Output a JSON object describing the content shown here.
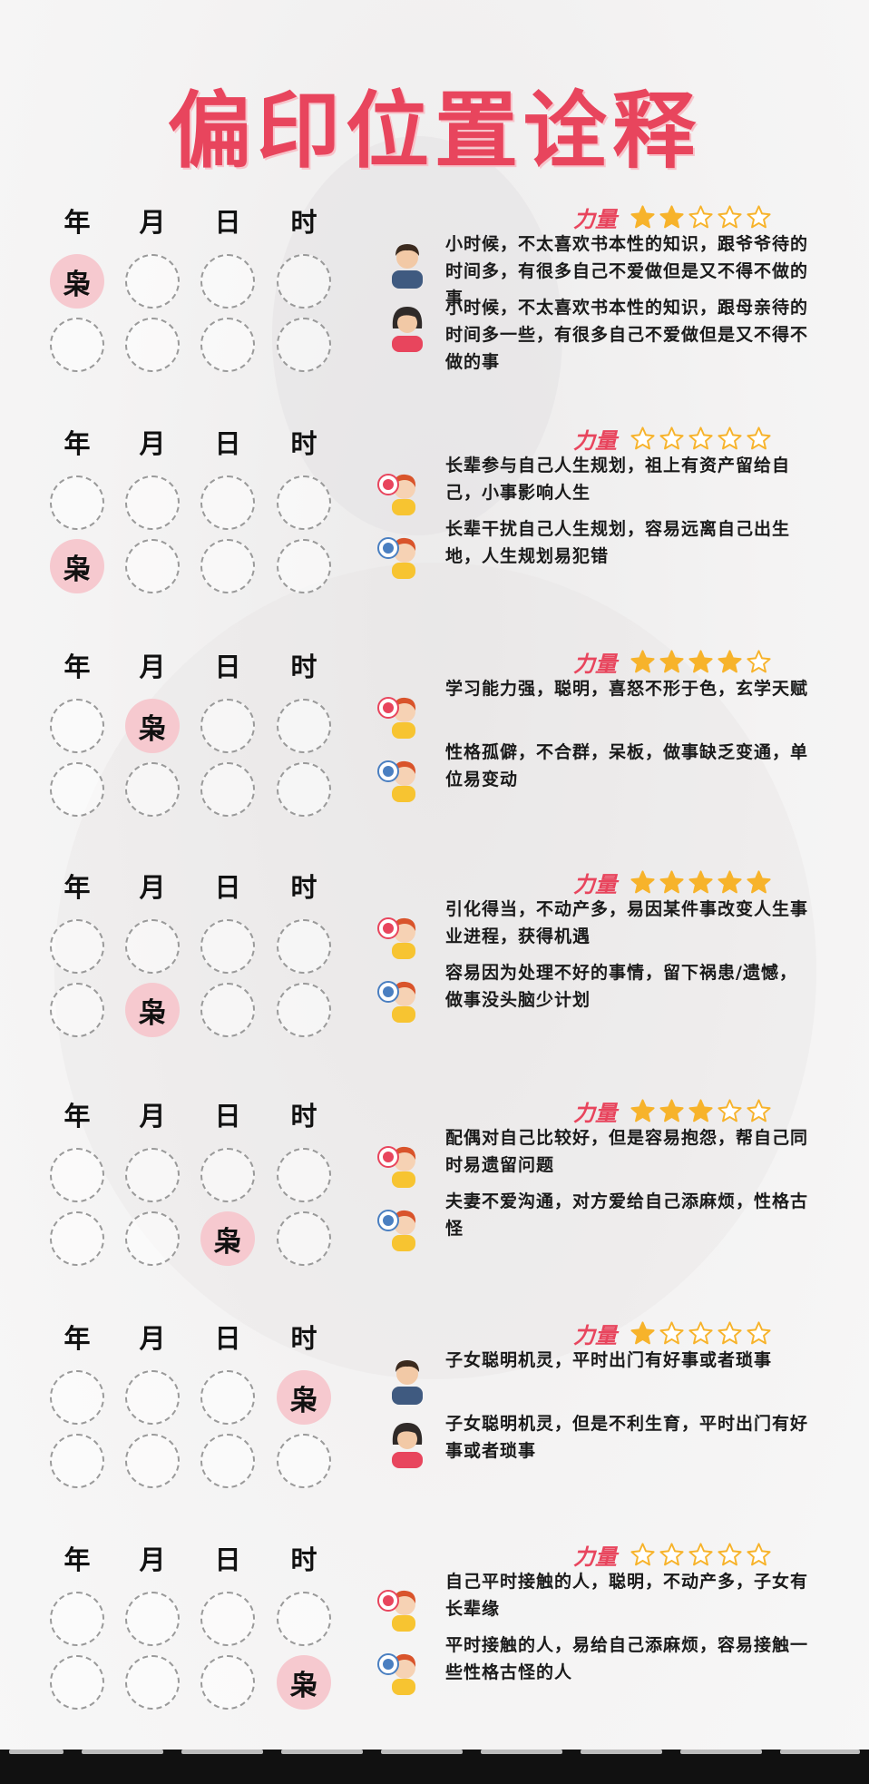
{
  "title": "偏印位置诠释",
  "columns": [
    "年",
    "月",
    "日",
    "时"
  ],
  "active_char": "枭",
  "power_label": "力量",
  "colors": {
    "accent": "#e8455d",
    "star": "#f7b32b",
    "active_circle": "#f6c9cf"
  },
  "sections": [
    {
      "active": {
        "row": 0,
        "col": 0
      },
      "stars": 2,
      "avatar_type": "person",
      "entries": [
        {
          "icon": "male-avatar-icon",
          "text": "小时候，不太喜欢书本性的知识，跟爷爷待的时间多，有很多自己不爱做但是又不得不做的事"
        },
        {
          "icon": "female-avatar-icon",
          "text": "小时候，不太喜欢书本性的知识，跟母亲待的时间多一些，有很多自己不爱做但是又不得不做的事"
        }
      ]
    },
    {
      "active": {
        "row": 1,
        "col": 0
      },
      "stars": 0,
      "avatar_type": "face",
      "entries": [
        {
          "icon": "happy-face-icon",
          "text": "长辈参与自己人生规划，祖上有资产留给自己，小事影响人生"
        },
        {
          "icon": "worried-face-icon",
          "text": "长辈干扰自己人生规划，容易远离自己出生地，人生规划易犯错"
        }
      ]
    },
    {
      "active": {
        "row": 0,
        "col": 1
      },
      "stars": 4,
      "avatar_type": "face",
      "entries": [
        {
          "icon": "happy-face-icon",
          "text": "学习能力强，聪明，喜怒不形于色，玄学天赋"
        },
        {
          "icon": "worried-face-icon",
          "text": "性格孤僻，不合群，呆板，做事缺乏变通，单位易变动"
        }
      ]
    },
    {
      "active": {
        "row": 1,
        "col": 1
      },
      "stars": 5,
      "avatar_type": "face",
      "entries": [
        {
          "icon": "happy-face-icon",
          "text": "引化得当，不动产多，易因某件事改变人生事业进程，获得机遇"
        },
        {
          "icon": "worried-face-icon",
          "text": "容易因为处理不好的事情，留下祸患/遗憾，做事没头脑少计划"
        }
      ]
    },
    {
      "active": {
        "row": 1,
        "col": 2
      },
      "stars": 3,
      "avatar_type": "face",
      "entries": [
        {
          "icon": "happy-face-icon",
          "text": "配偶对自己比较好，但是容易抱怨，帮自己同时易遗留问题"
        },
        {
          "icon": "worried-face-icon",
          "text": "夫妻不爱沟通，对方爱给自己添麻烦，性格古怪"
        }
      ]
    },
    {
      "active": {
        "row": 0,
        "col": 3
      },
      "stars": 1,
      "avatar_type": "person",
      "entries": [
        {
          "icon": "male-avatar-icon",
          "text": "子女聪明机灵，平时出门有好事或者琐事"
        },
        {
          "icon": "female-avatar-icon",
          "text": "子女聪明机灵，但是不利生育，平时出门有好事或者琐事"
        }
      ]
    },
    {
      "active": {
        "row": 1,
        "col": 3
      },
      "stars": 0,
      "avatar_type": "face",
      "entries": [
        {
          "icon": "happy-face-icon",
          "text": "自己平时接触的人，聪明，不动产多，子女有长辈缘"
        },
        {
          "icon": "worried-face-icon",
          "text": "平时接触的人，易给自己添麻烦，容易接触一些性格古怪的人"
        }
      ]
    }
  ]
}
